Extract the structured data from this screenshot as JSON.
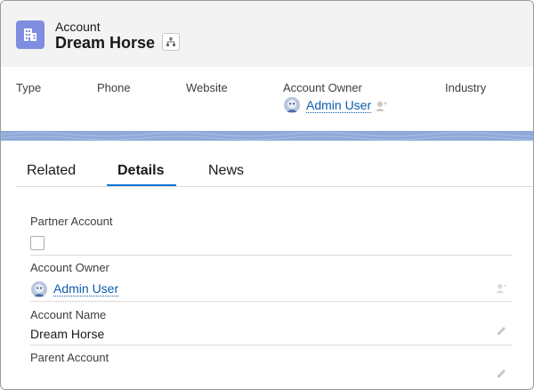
{
  "header": {
    "object_label": "Account",
    "record_title": "Dream Horse",
    "icon": "account-building-icon",
    "hierarchy_icon": "hierarchy-icon"
  },
  "highlights": {
    "fields": [
      {
        "label": "Type"
      },
      {
        "label": "Phone"
      },
      {
        "label": "Website"
      },
      {
        "label": "Account Owner",
        "value": "Admin User"
      },
      {
        "label": "Industry"
      }
    ]
  },
  "tabs": [
    {
      "label": "Related",
      "active": false
    },
    {
      "label": "Details",
      "active": true
    },
    {
      "label": "News",
      "active": false
    }
  ],
  "details": {
    "partner_account": {
      "label": "Partner Account",
      "checked": false
    },
    "account_owner": {
      "label": "Account Owner",
      "value": "Admin User"
    },
    "account_name": {
      "label": "Account Name",
      "value": "Dream Horse"
    },
    "parent_account": {
      "label": "Parent Account",
      "value": ""
    }
  },
  "colors": {
    "brand_blue": "#0176d3",
    "link": "#0b5cab",
    "account_icon": "#7f8de1",
    "header_bg": "#f3f3f3"
  }
}
